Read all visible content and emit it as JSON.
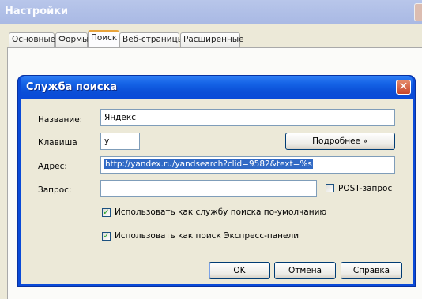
{
  "outer_window": {
    "title": "Настройки",
    "tabs": [
      {
        "label": "Основные"
      },
      {
        "label": "Формы"
      },
      {
        "label": "Поиск"
      },
      {
        "label": "Веб-страницы"
      },
      {
        "label": "Расширенные"
      }
    ],
    "active_tab": "Поиск"
  },
  "dialog": {
    "title": "Служба поиска",
    "close_glyph": "✕",
    "name_label": "Название:",
    "name_value": "Яндекс",
    "key_label": "Клавиша",
    "key_value": "y",
    "details_button": "Подробнее «",
    "address_label": "Адрес:",
    "address_value": "http://yandex.ru/yandsearch?clid=9582&text=%s",
    "query_label": "Запрос:",
    "query_value": "",
    "post_label": "POST-запрос",
    "post_checked": false,
    "default_label": "Использовать как службу поиска по-умолчанию",
    "default_checked": true,
    "express_label": "Использовать как поиск Экспресс-панели",
    "express_checked": true,
    "ok_button": "OK",
    "cancel_button": "Отмена",
    "help_button": "Справка",
    "check_glyph": "✓",
    "colors": {
      "title_bar": "#0a4ad8",
      "selection": "#316ac5",
      "check": "#21a121"
    }
  }
}
